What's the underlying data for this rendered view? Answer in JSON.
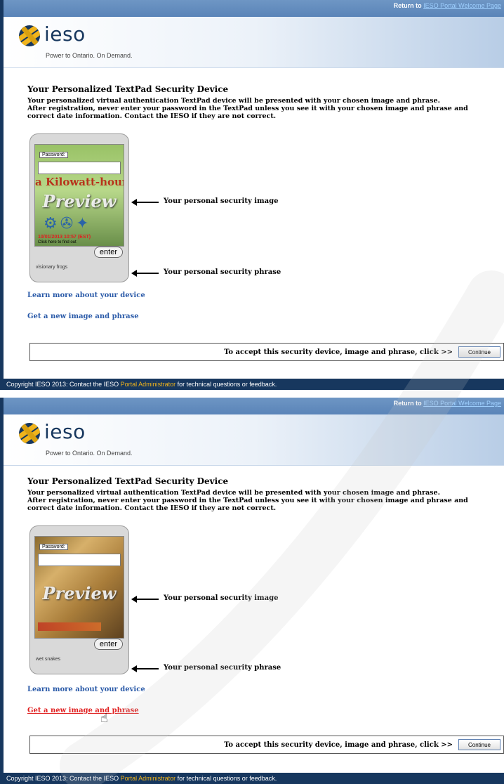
{
  "topbar": {
    "return_prefix": "Return to",
    "return_link": "IESO Portal Welcome Page"
  },
  "brand": {
    "wordmark": "ieso",
    "tagline": "Power to Ontario. On Demand."
  },
  "content": {
    "title": "Your Personalized TextPad Security Device",
    "description_line1": "Your personalized virtual authentication TextPad device will be presented with your chosen image and phrase.",
    "description_line2": "After registration, never enter your password in the TextPad unless you see it with your chosen image and phrase and",
    "description_line3": "correct date information. Contact the IESO if they are not correct."
  },
  "device": {
    "password_label": "Password:",
    "preview_text": "Preview",
    "enter_label": "enter"
  },
  "panel1": {
    "image_caption": "a Kilowatt-hour?",
    "datetime": "10/01/2013 10:57 (EST)",
    "hint": "Click here to find out",
    "phrase": "visionary frogs"
  },
  "panel2": {
    "phrase": "wet snakes"
  },
  "labels": {
    "security_image": "Your personal security image",
    "security_phrase": "Your personal security phrase",
    "learn_more": "Learn more about your device",
    "new_image": "Get a new image and phrase",
    "accept": "To accept this security device, image and phrase, click >>",
    "continue": "Continue"
  },
  "footer": {
    "prefix": "Copyright IESO 2013: Contact the IESO",
    "admin": "Portal Administrator",
    "suffix": "for technical questions or feedback."
  },
  "colors": {
    "navy": "#17375e",
    "gold": "#f0b41c",
    "link_blue": "#2a5aa8",
    "link_red": "#e02020"
  }
}
